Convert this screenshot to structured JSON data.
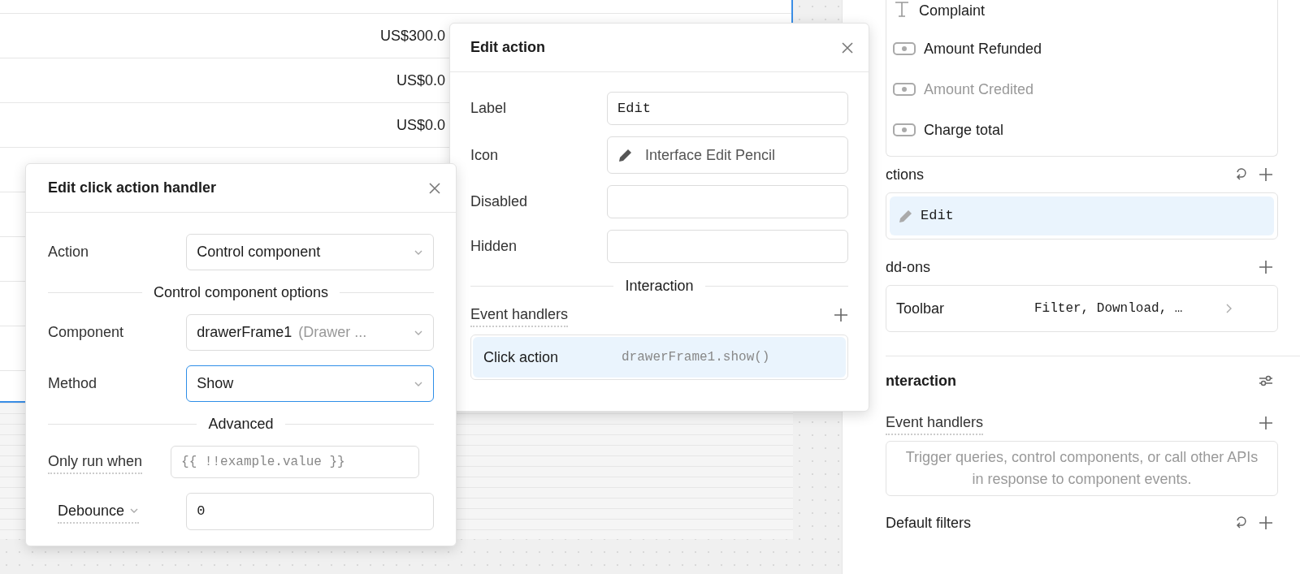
{
  "table": {
    "cells": [
      "US$300.0",
      "US$0.0",
      "US$0.0"
    ]
  },
  "inspector": {
    "columns": [
      {
        "label": "Complaint",
        "kind": "text",
        "disabled": false
      },
      {
        "label": "Amount Refunded",
        "kind": "money",
        "disabled": false
      },
      {
        "label": "Amount Credited",
        "kind": "money",
        "disabled": true
      },
      {
        "label": "Charge total",
        "kind": "money",
        "disabled": false
      }
    ],
    "actions_title": "ctions",
    "actions": [
      {
        "label": "Edit",
        "selected": true
      }
    ],
    "addons_title": "dd-ons",
    "addons": [
      {
        "label": "Toolbar",
        "value": "Filter, Download, …"
      }
    ],
    "interaction_title": "nteraction",
    "event_handlers_title": "Event handlers",
    "event_handlers_empty": "Trigger queries, control components, or call other APIs in response to component events.",
    "default_filters_title": "Default filters"
  },
  "edit_action": {
    "title": "Edit action",
    "fields": [
      {
        "label": "Label",
        "kind": "text",
        "value": "Edit"
      },
      {
        "label": "Icon",
        "kind": "icon",
        "value": "Interface Edit Pencil"
      },
      {
        "label": "Disabled",
        "kind": "text"
      },
      {
        "label": "Hidden",
        "kind": "text"
      }
    ],
    "section": "Interaction",
    "event_handlers_title": "Event handlers",
    "handlers": [
      {
        "event": "Click action",
        "code": "drawerFrame1.show()",
        "selected": true
      }
    ]
  },
  "handler_dialog": {
    "title": "Edit click action handler",
    "rows": [
      {
        "kind": "select",
        "label": "Action",
        "value": "Control component",
        "focused": false
      },
      {
        "kind": "divider",
        "label": "Control component options"
      },
      {
        "kind": "select",
        "label": "Component",
        "value": "drawerFrame1",
        "hint": "(Drawer ...",
        "focused": false
      },
      {
        "kind": "select",
        "label": "Method",
        "value": "Show",
        "focused": true
      },
      {
        "kind": "divider",
        "label": "Advanced"
      },
      {
        "kind": "input",
        "label": "Only run when",
        "placeholder": "{{ !!example.value }}"
      },
      {
        "kind": "dropinput",
        "label": "Debounce",
        "value": "0"
      }
    ]
  }
}
